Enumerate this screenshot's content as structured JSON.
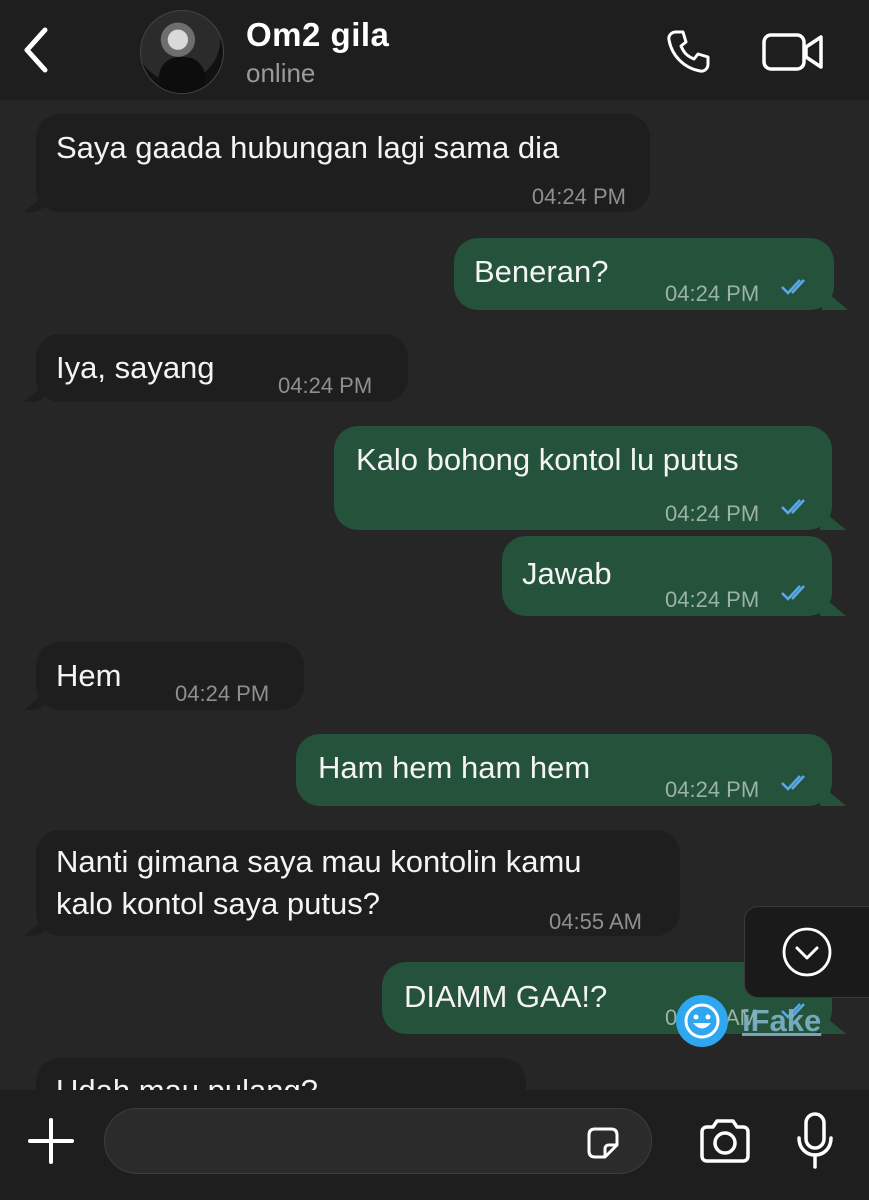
{
  "header": {
    "contact_name": "Om2 gila",
    "status": "online",
    "back_icon": "chevron-left-icon",
    "call_icon": "phone-icon",
    "video_icon": "video-camera-icon"
  },
  "messages": [
    {
      "direction": "incoming",
      "text": "Saya gaada hubungan lagi sama dia",
      "time": "04:24 PM"
    },
    {
      "direction": "outgoing",
      "text": "Beneran?",
      "time": "04:24 PM",
      "status": "read"
    },
    {
      "direction": "incoming",
      "text": "Iya, sayang",
      "time": "04:24 PM"
    },
    {
      "direction": "outgoing",
      "text": "Kalo bohong kontol lu putus",
      "time": "04:24 PM",
      "status": "read"
    },
    {
      "direction": "outgoing",
      "text": "Jawab",
      "time": "04:24 PM",
      "status": "read"
    },
    {
      "direction": "incoming",
      "text": "Hem",
      "time": "04:24 PM"
    },
    {
      "direction": "outgoing",
      "text": "Ham hem ham hem",
      "time": "04:24 PM",
      "status": "read"
    },
    {
      "direction": "incoming",
      "text": "Nanti gimana saya mau kontolin kamu\nkalo kontol saya putus?",
      "time": "04:55 AM"
    },
    {
      "direction": "outgoing",
      "text": "DIAMM GAA!?",
      "time": "04:55 AM",
      "status": "read"
    },
    {
      "direction": "incoming",
      "text": "Udah mau pulang?",
      "time": ""
    }
  ],
  "watermark": {
    "text": "iFake"
  },
  "input": {
    "placeholder": ""
  },
  "colors": {
    "background": "#262626",
    "incoming_bubble": "#1e1e1e",
    "outgoing_bubble": "#24523a",
    "read_ticks": "#5aa9e6"
  }
}
